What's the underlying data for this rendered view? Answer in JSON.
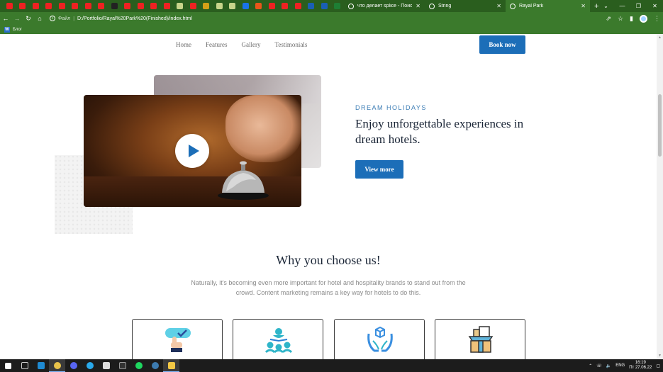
{
  "browser": {
    "pinned_tab_colors": [
      "#e22",
      "#e22",
      "#e22",
      "#e22",
      "#e22",
      "#e22",
      "#e22",
      "#e22",
      "#222",
      "#e22",
      "#e22",
      "#e22",
      "#e22",
      "#c8d48a",
      "#e22",
      "#d4a017",
      "#c8d48a",
      "#c8d48a",
      "#1a73e8",
      "#e8561a",
      "#e22",
      "#e22",
      "#e22",
      "#1a5fb4",
      "#1a5fb4",
      "#1e7e34"
    ],
    "tabs": [
      {
        "title": "что делает splice - Поиск в Goo"
      },
      {
        "title": "String"
      },
      {
        "title": "Rayal Park"
      }
    ],
    "new_tab_label": "+",
    "address": {
      "scheme_label": "Файл",
      "url": "D:/Portfolio/Rayal%20Park%20(Finished)/index.html"
    },
    "bookmarks": [
      {
        "label": "Блог"
      }
    ]
  },
  "site": {
    "nav": [
      "Home",
      "Features",
      "Gallery",
      "Testimonials"
    ],
    "book_button": "Book now",
    "eyebrow": "DREAM HOLIDAYS",
    "headline": "Enjoy unforgettable experiences in dream hotels.",
    "view_button": "View more",
    "why_title": "Why you choose us!",
    "why_text": "Naturally, it's becoming even more important for hotel and hospitality brands to stand out from the crowd. Content marketing remains a key way for hotels to do this.",
    "feature_icons": [
      "touch-screen-icon",
      "connected-people-icon",
      "hand-holding-box-icon",
      "open-box-icon"
    ],
    "accent_color": "#1c6eb8"
  },
  "taskbar": {
    "language": "ENG",
    "time": "16:19",
    "date": "Пт 27.06.22"
  }
}
